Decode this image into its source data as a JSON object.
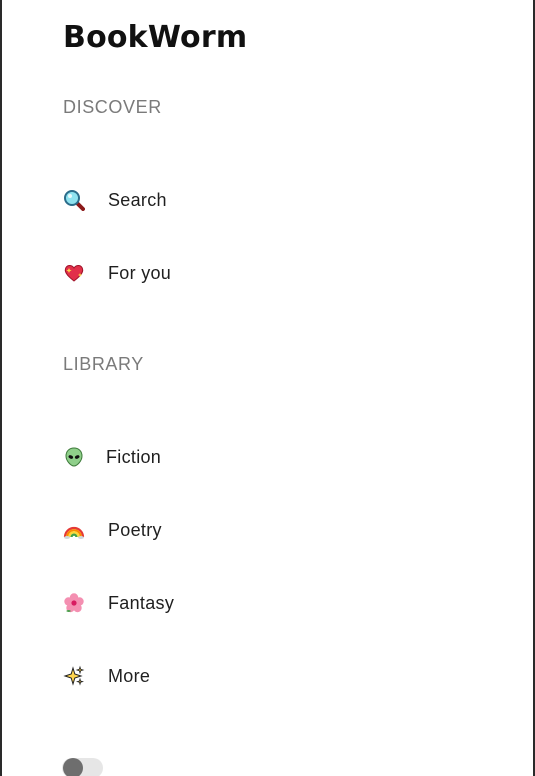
{
  "app": {
    "title": "BookWorm"
  },
  "sections": {
    "discover": {
      "title": "DISCOVER"
    },
    "library": {
      "title": "LIBRARY"
    }
  },
  "nav": {
    "search": {
      "label": "Search",
      "icon": "magnifying-glass-icon"
    },
    "for_you": {
      "label": "For you",
      "icon": "sparkling-heart-icon"
    },
    "fiction": {
      "label": "Fiction",
      "icon": "alien-icon"
    },
    "poetry": {
      "label": "Poetry",
      "icon": "rainbow-icon"
    },
    "fantasy": {
      "label": "Fantasy",
      "icon": "hibiscus-icon"
    },
    "more": {
      "label": "More",
      "icon": "sparkles-icon"
    }
  },
  "theme_toggle": {
    "state": "off"
  }
}
